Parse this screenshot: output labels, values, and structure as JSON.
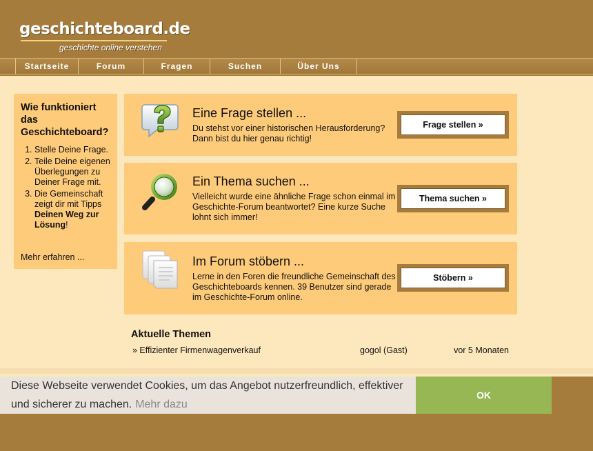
{
  "logo": {
    "title": "geschichteboard.de",
    "subtitle": "geschichte online verstehen"
  },
  "nav": {
    "items": [
      {
        "label": "Startseite"
      },
      {
        "label": "Forum"
      },
      {
        "label": "Fragen"
      },
      {
        "label": "Suchen"
      },
      {
        "label": "Über Uns"
      }
    ]
  },
  "sidebar": {
    "title": "Wie funktioniert das Geschichteboard?",
    "step1": "Stelle Deine Frage.",
    "step2": "Teile Deine eigenen Überlegungen zu Deiner Frage mit.",
    "step3_pre": "Die Gemeinschaft zeigt dir mit Tipps ",
    "step3_bold": "Deinen Weg zur Lösung",
    "step3_post": "!",
    "more": "Mehr erfahren ..."
  },
  "cards": [
    {
      "title": "Eine Frage stellen ...",
      "text": "Du stehst vor einer historischen Herausforderung? Dann bist du hier genau richtig!",
      "button": "Frage stellen »",
      "icon": "question-bubble-icon"
    },
    {
      "title": "Ein Thema suchen ...",
      "text": "Vielleicht wurde eine ähnliche Frage schon einmal im Geschichte-Forum beantwortet? Eine kurze Suche lohnt sich immer!",
      "button": "Thema suchen »",
      "icon": "magnifier-icon"
    },
    {
      "title": "Im Forum stöbern ...",
      "text": "Lerne in den Foren die freundliche Gemeinschaft des Geschichteboards kennen. 39 Benutzer sind gerade im Geschichte-Forum online.",
      "button": "Stöbern »",
      "icon": "documents-icon"
    }
  ],
  "topics": {
    "title": "Aktuelle Themen",
    "rows": [
      {
        "title": "» Effizienter Firmenwagenverkauf",
        "author": "gogol (Gast)",
        "time": "vor 5 Monaten"
      }
    ]
  },
  "cookie": {
    "text": "Diese Webseite verwendet Cookies, um das Angebot nutzerfreundlich, effektiver und sicherer zu machen.",
    "link": "Mehr dazu",
    "ok": "OK"
  },
  "colors": {
    "brown": "#a67c3d",
    "card": "#fecb7a",
    "content_bg": "#fde7bc",
    "ok_green": "#97b654",
    "banner_bg": "#e9e3dc"
  }
}
